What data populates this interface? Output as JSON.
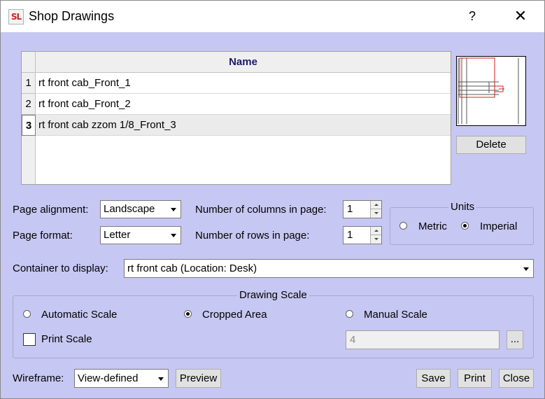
{
  "window": {
    "title": "Shop Drawings",
    "app_icon_text": "SL",
    "help_glyph": "?",
    "close_glyph": "✕"
  },
  "table": {
    "column_header": "Name",
    "rows": [
      {
        "num": "1",
        "name": "rt front cab_Front_1"
      },
      {
        "num": "2",
        "name": "rt front cab_Front_2"
      },
      {
        "num": "3",
        "name": "rt front cab zzom 1/8_Front_3",
        "selected": true
      }
    ]
  },
  "preview": {
    "delete_label": "Delete"
  },
  "page_alignment": {
    "label": "Page alignment:",
    "value": "Landscape"
  },
  "page_format": {
    "label": "Page format:",
    "value": "Letter"
  },
  "columns": {
    "label": "Number of columns in page:",
    "value": "1"
  },
  "rows_in_page": {
    "label": "Number of rows in page:",
    "value": "1"
  },
  "units": {
    "title": "Units",
    "metric": "Metric",
    "imperial": "Imperial",
    "selected": "Imperial"
  },
  "container": {
    "label": "Container to display:",
    "value": "rt front cab (Location: Desk)"
  },
  "drawing_scale": {
    "title": "Drawing Scale",
    "automatic": "Automatic Scale",
    "cropped": "Cropped Area",
    "manual": "Manual Scale",
    "selected": "Cropped Area",
    "print_scale": "Print Scale",
    "print_scale_checked": false,
    "manual_value": "4",
    "browse_label": "..."
  },
  "wireframe": {
    "label": "Wireframe:",
    "value": "View-defined"
  },
  "buttons": {
    "preview": "Preview",
    "save": "Save",
    "print": "Print",
    "close": "Close"
  },
  "colors": {
    "dialog_bg": "#c7c7f3",
    "header_text": "#1a1a6c",
    "preview_accent": "#d02020"
  }
}
